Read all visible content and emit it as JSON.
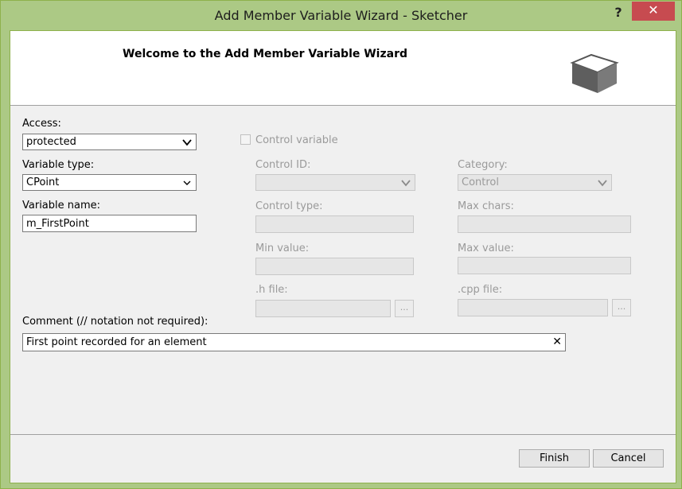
{
  "window": {
    "title": "Add Member Variable Wizard - Sketcher",
    "help_glyph": "?",
    "close_glyph": "✕"
  },
  "header": {
    "title": "Welcome to the Add Member Variable Wizard",
    "icon": "wizard-box-icon"
  },
  "form": {
    "access": {
      "label": "Access:",
      "value": "protected"
    },
    "variable_type": {
      "label": "Variable type:",
      "value": "CPoint"
    },
    "variable_name": {
      "label": "Variable name:",
      "value": "m_FirstPoint"
    },
    "control_variable": {
      "label": "Control variable",
      "checked": false
    },
    "control_id": {
      "label": "Control ID:",
      "value": ""
    },
    "category": {
      "label": "Category:",
      "value": "Control"
    },
    "control_type": {
      "label": "Control type:",
      "value": ""
    },
    "max_chars": {
      "label": "Max chars:",
      "value": ""
    },
    "min_value": {
      "label": "Min value:",
      "value": ""
    },
    "max_value": {
      "label": "Max value:",
      "value": ""
    },
    "h_file": {
      "label": ".h file:",
      "value": "",
      "browse": "..."
    },
    "cpp_file": {
      "label": ".cpp file:",
      "value": "",
      "browse": "..."
    },
    "comment": {
      "label": "Comment (// notation not required):",
      "value": "First point recorded for an element",
      "clear_glyph": "✕"
    }
  },
  "buttons": {
    "finish": "Finish",
    "cancel": "Cancel"
  }
}
